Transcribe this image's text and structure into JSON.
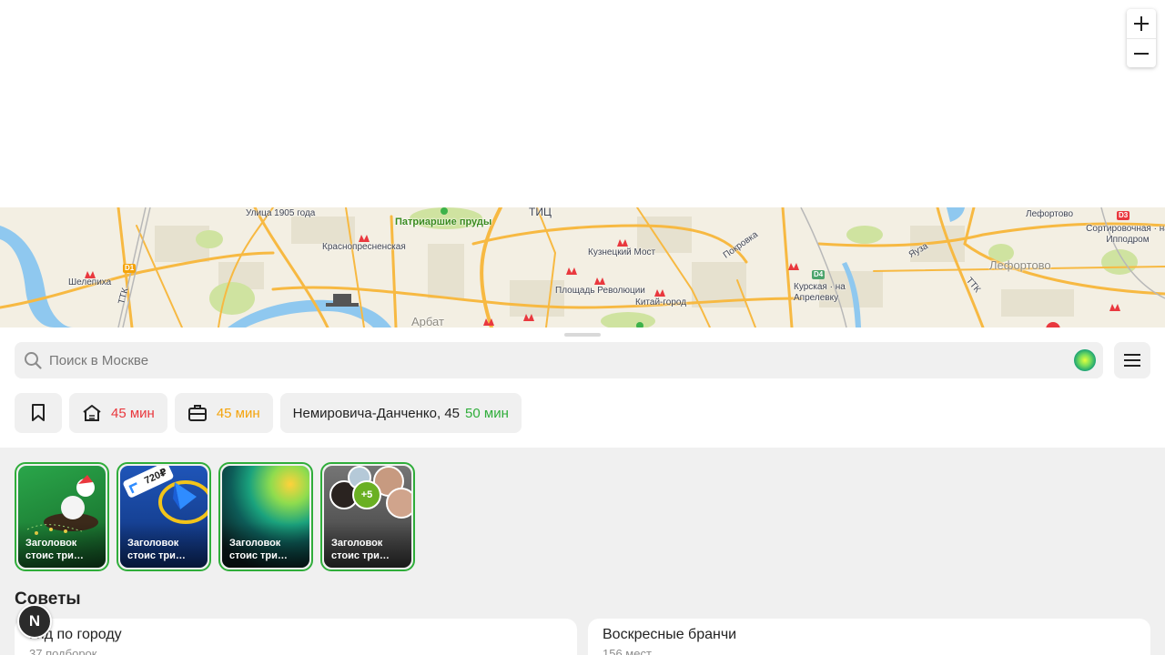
{
  "zoom": {
    "in_symbol": "+",
    "out_symbol": "−"
  },
  "map": {
    "labels": {
      "street_1905": "Улица 1905 года",
      "patriarshie": "Патриаршие пруды",
      "krasnopresnenskaya": "Краснопресненская",
      "shelepikha": "Шелепиха",
      "kuznetsky": "Кузнецкий Мост",
      "ploshchad": "Площадь Революции",
      "kitay_gorod": "Китай-город",
      "pokrovka": "Покровка",
      "kurskaya": "Курская · на Апрелевку",
      "lefortovo_station": "Лефортово",
      "lefortovo_district": "Лефортово",
      "sortirovochnaya": "Сортировочная · на Ипподром",
      "arbat": "Арбат",
      "tits": "ТИЦ",
      "yauza": "Яуза",
      "ttk_left": "ТТК",
      "ttk_right": "ТТК",
      "d1": "D1",
      "d3": "D3",
      "d4": "D4"
    }
  },
  "search": {
    "placeholder": "Поиск в Москве"
  },
  "chips": {
    "home_time": "45 мин",
    "work_time": "45 мин",
    "address": "Немировича-Данченко, 45",
    "address_time": "50 мин"
  },
  "stories": [
    {
      "title": "Заголовок стоис три…"
    },
    {
      "title": "Заголовок стоис три…"
    },
    {
      "title": "Заголовок стоис три…"
    },
    {
      "title": "Заголовок стоис три…",
      "avatars_more": "+5"
    }
  ],
  "story_badge": "720₽",
  "section": {
    "title": "Советы"
  },
  "cards": [
    {
      "title": "Гид по городу",
      "subtitle": "37 подборок"
    },
    {
      "title": "Воскресные бранчи",
      "subtitle": "156 мест"
    }
  ],
  "n_button": "N",
  "colors": {
    "accent_green": "#2fad3a",
    "red": "#e9383e",
    "orange": "#f4a30a",
    "road": "#f7b942"
  }
}
